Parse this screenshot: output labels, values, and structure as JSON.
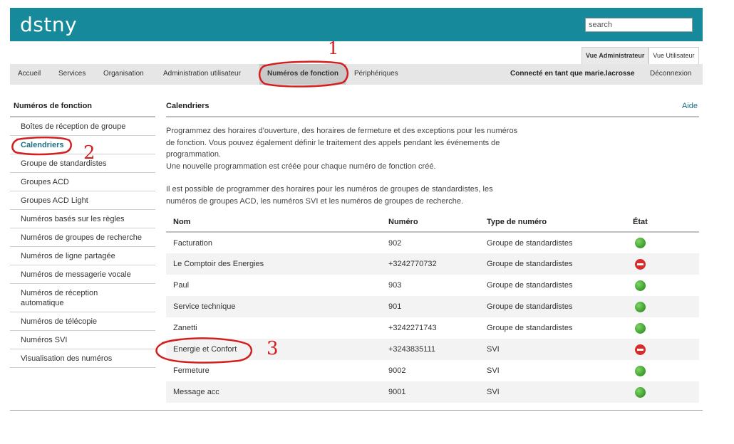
{
  "brand": {
    "logo_text": "dstny",
    "accent_dot_color": "#f59c1a",
    "header_color": "#168a9a"
  },
  "search": {
    "placeholder": "search",
    "value": "search"
  },
  "view_tabs": {
    "admin": "Vue Administrateur",
    "user": "Vue Utilisateur",
    "active": "admin"
  },
  "nav": {
    "items": [
      "Accueil",
      "Services",
      "Organisation",
      "Administration utilisateur",
      "Numéros de fonction",
      "Périphériques"
    ],
    "active": "Numéros de fonction",
    "connected_label": "Connecté en tant que marie.lacrosse",
    "logout": "Déconnexion"
  },
  "sidebar": {
    "title": "Numéros de fonction",
    "items": [
      "Boîtes de réception de groupe",
      "Calendriers",
      "Groupe de standardistes",
      "Groupes ACD",
      "Groupes ACD Light",
      "Numéros basés sur les règles",
      "Numéros de groupes de recherche",
      "Numéros de ligne partagée",
      "Numéros de messagerie vocale",
      "Numéros de réception automatique",
      "Numéros de télécopie",
      "Numéros SVI",
      "Visualisation des numéros"
    ],
    "active": "Calendriers"
  },
  "main": {
    "title": "Calendriers",
    "help": "Aide",
    "desc1": "Programmez des horaires d'ouverture, des horaires de fermeture et des exceptions pour les numéros de fonction. Vous pouvez également définir le traitement des appels pendant les événements de programmation.",
    "desc2": "Une nouvelle programmation est créée pour chaque numéro de fonction créé.",
    "desc3": "Il est possible de programmer des horaires pour les numéros de groupes de standardistes, les numéros de groupes ACD, les numéros SVI et les numéros de groupes de recherche.",
    "columns": {
      "name": "Nom",
      "number": "Numéro",
      "type": "Type de numéro",
      "state": "État"
    },
    "rows": [
      {
        "name": "Facturation",
        "number": "902",
        "type": "Groupe de standardistes",
        "state": "active"
      },
      {
        "name": "Le Comptoir des Energies",
        "number": "+3242770732",
        "type": "Groupe de standardistes",
        "state": "inactive"
      },
      {
        "name": "Paul",
        "number": "903",
        "type": "Groupe de standardistes",
        "state": "active"
      },
      {
        "name": "Service technique",
        "number": "901",
        "type": "Groupe de standardistes",
        "state": "active"
      },
      {
        "name": "Zanetti",
        "number": "+3242271743",
        "type": "Groupe de standardistes",
        "state": "active"
      },
      {
        "name": "Energie et Confort",
        "number": "+3243835111",
        "type": "SVI",
        "state": "inactive"
      },
      {
        "name": "Fermeture",
        "number": "9002",
        "type": "SVI",
        "state": "active"
      },
      {
        "name": "Message acc",
        "number": "9001",
        "type": "SVI",
        "state": "active"
      }
    ]
  },
  "annotations": {
    "mark1": "1",
    "mark2": "2",
    "mark3": "3",
    "color": "#d31f1f"
  }
}
